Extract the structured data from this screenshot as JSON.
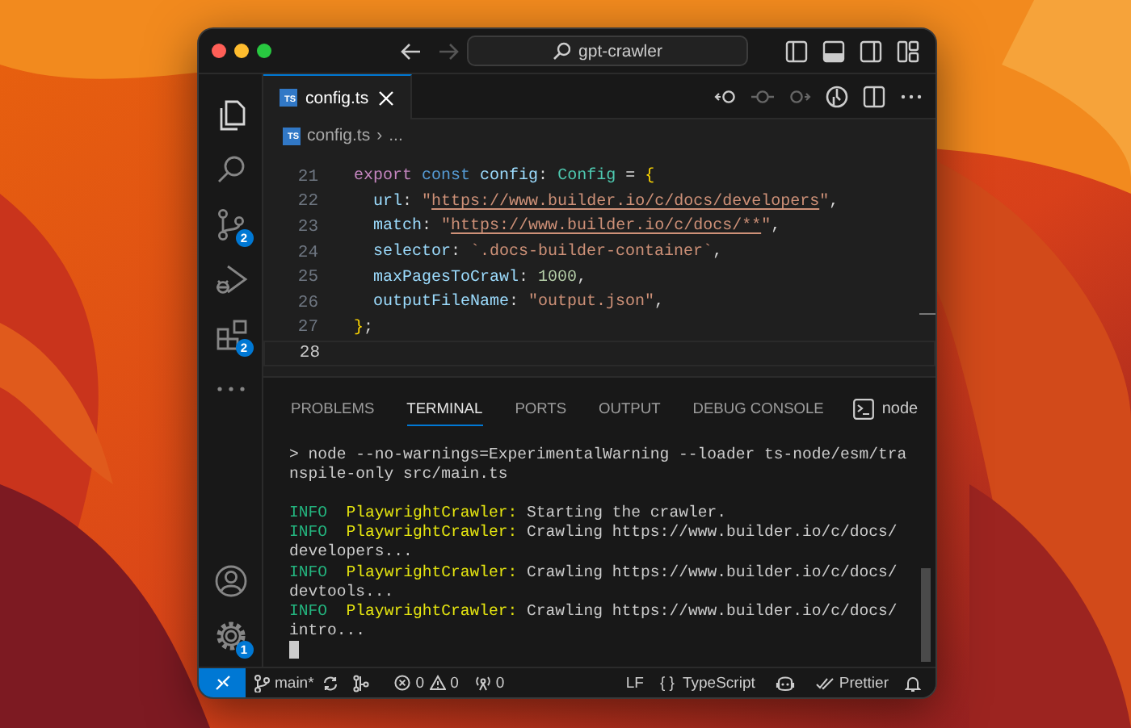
{
  "window": {
    "title": "gpt-crawler"
  },
  "activity_bar": {
    "source_control_badge": "2",
    "extensions_badge": "2",
    "settings_badge": "1"
  },
  "editor": {
    "tabs": [
      {
        "label": "config.ts",
        "file_icon": "TS",
        "selected": true
      }
    ],
    "breadcrumb_icon": "TS",
    "breadcrumb": [
      "config.ts",
      "›",
      "..."
    ],
    "lines": [
      {
        "number": "21",
        "current": false,
        "tokens": [
          {
            "text": "export ",
            "kind": "keyword"
          },
          {
            "text": "const ",
            "kind": "storage"
          },
          {
            "text": "config",
            "kind": "variable"
          },
          {
            "text": ": ",
            "kind": "plain"
          },
          {
            "text": "Config",
            "kind": "type"
          },
          {
            "text": " = ",
            "kind": "plain"
          },
          {
            "text": "{",
            "kind": "brace"
          }
        ]
      },
      {
        "number": "22",
        "current": false,
        "tokens": [
          {
            "text": "  url",
            "kind": "variable"
          },
          {
            "text": ": ",
            "kind": "plain"
          },
          {
            "text": "\"",
            "kind": "string"
          },
          {
            "text": "https://www.builder.io/c/docs/developers",
            "kind": "link"
          },
          {
            "text": "\"",
            "kind": "string"
          },
          {
            "text": ",",
            "kind": "plain"
          }
        ]
      },
      {
        "number": "23",
        "current": false,
        "tokens": [
          {
            "text": "  match",
            "kind": "variable"
          },
          {
            "text": ": ",
            "kind": "plain"
          },
          {
            "text": "\"",
            "kind": "string"
          },
          {
            "text": "https://www.builder.io/c/docs/**",
            "kind": "link"
          },
          {
            "text": "\"",
            "kind": "string"
          },
          {
            "text": ",",
            "kind": "plain"
          }
        ]
      },
      {
        "number": "24",
        "current": false,
        "tokens": [
          {
            "text": "  selector",
            "kind": "variable"
          },
          {
            "text": ": ",
            "kind": "plain"
          },
          {
            "text": "`.docs-builder-container`",
            "kind": "string"
          },
          {
            "text": ",",
            "kind": "plain"
          }
        ]
      },
      {
        "number": "25",
        "current": false,
        "tokens": [
          {
            "text": "  maxPagesToCrawl",
            "kind": "variable"
          },
          {
            "text": ": ",
            "kind": "plain"
          },
          {
            "text": "1000",
            "kind": "number"
          },
          {
            "text": ",",
            "kind": "plain"
          }
        ]
      },
      {
        "number": "26",
        "current": false,
        "tokens": [
          {
            "text": "  outputFileName",
            "kind": "variable"
          },
          {
            "text": ": ",
            "kind": "plain"
          },
          {
            "text": "\"output.json\"",
            "kind": "string"
          },
          {
            "text": ",",
            "kind": "plain"
          }
        ]
      },
      {
        "number": "27",
        "current": false,
        "tokens": [
          {
            "text": "}",
            "kind": "brace"
          },
          {
            "text": ";",
            "kind": "plain"
          }
        ]
      },
      {
        "number": "28",
        "current": true
      }
    ]
  },
  "panel": {
    "tabs": [
      {
        "label": "PROBLEMS",
        "selected": false
      },
      {
        "label": "TERMINAL",
        "selected": true
      },
      {
        "label": "PORTS",
        "selected": false
      },
      {
        "label": "OUTPUT",
        "selected": false
      },
      {
        "label": "DEBUG CONSOLE",
        "selected": false
      }
    ],
    "terminal_name": "node",
    "terminal": [
      {
        "kind": "command",
        "text": "> node --no-warnings=ExperimentalWarning --loader ts-node/esm/transpile-only src/main.ts"
      },
      {
        "kind": "blank"
      },
      {
        "kind": "log",
        "level": "INFO",
        "source": "PlaywrightCrawler:",
        "message": "Starting the crawler."
      },
      {
        "kind": "log",
        "level": "INFO",
        "source": "PlaywrightCrawler:",
        "message": "Crawling https://www.builder.io/c/docs/developers..."
      },
      {
        "kind": "log",
        "level": "INFO",
        "source": "PlaywrightCrawler:",
        "message": "Crawling https://www.builder.io/c/docs/devtools..."
      },
      {
        "kind": "log",
        "level": "INFO",
        "source": "PlaywrightCrawler:",
        "message": "Crawling https://www.builder.io/c/docs/intro..."
      },
      {
        "kind": "cursor"
      }
    ]
  },
  "status_bar": {
    "branch": "main*",
    "errors": "0",
    "warnings": "0",
    "ports": "0",
    "eol": "LF",
    "language_icon": "{ }",
    "language": "TypeScript",
    "formatter": "Prettier"
  }
}
